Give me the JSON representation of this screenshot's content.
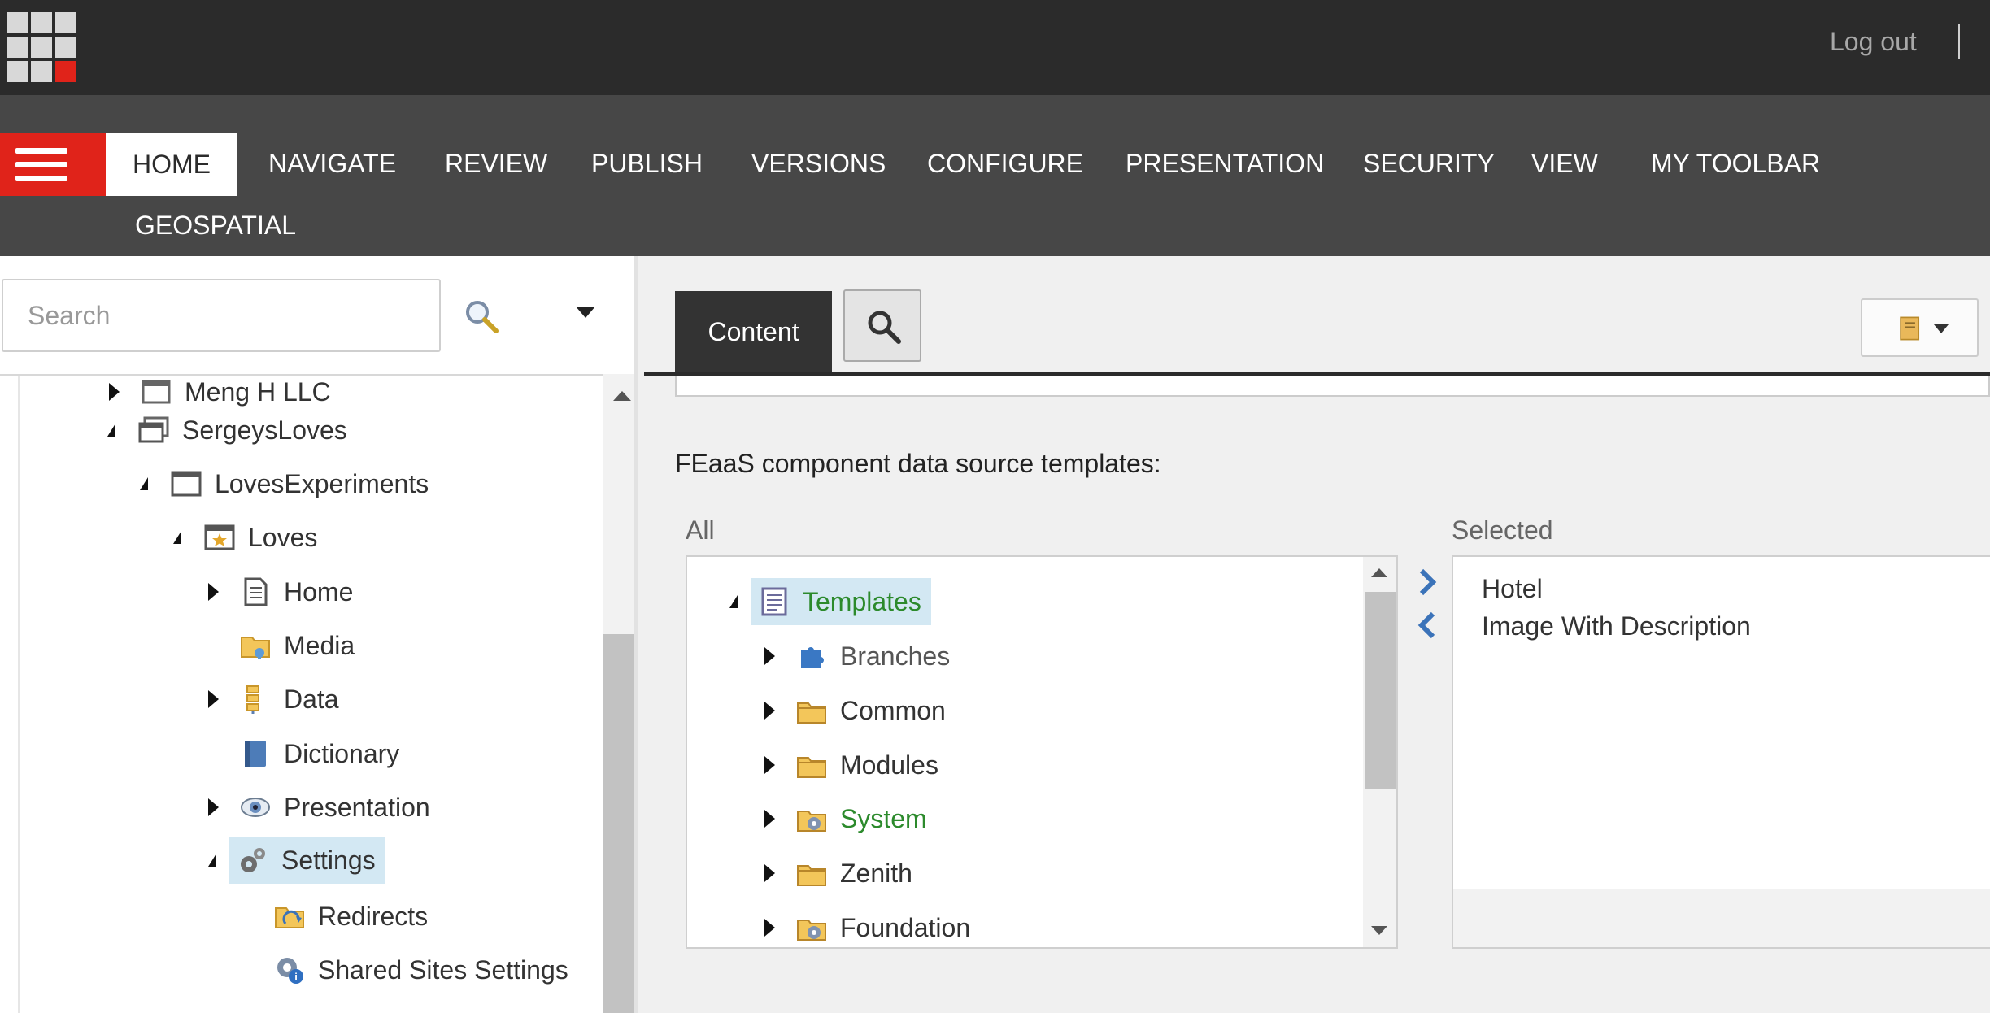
{
  "header": {
    "logout_label": "Log out"
  },
  "ribbon": {
    "tabs": [
      "HOME",
      "NAVIGATE",
      "REVIEW",
      "PUBLISH",
      "VERSIONS",
      "CONFIGURE",
      "PRESENTATION",
      "SECURITY",
      "VIEW",
      "MY TOOLBAR",
      "GEOSPATIAL"
    ],
    "active_tab": "HOME"
  },
  "left_panel": {
    "search_placeholder": "Search",
    "tree": [
      {
        "label": "Meng H LLC"
      },
      {
        "label": "SergeysLoves"
      },
      {
        "label": "LovesExperiments"
      },
      {
        "label": "Loves"
      },
      {
        "label": "Home"
      },
      {
        "label": "Media"
      },
      {
        "label": "Data"
      },
      {
        "label": "Dictionary"
      },
      {
        "label": "Presentation"
      },
      {
        "label": "Settings"
      },
      {
        "label": "Redirects"
      },
      {
        "label": "Shared Sites Settings"
      }
    ]
  },
  "editor": {
    "content_tab_label": "Content",
    "field_label": "FEaaS component data source templates:",
    "all_label": "All",
    "selected_label": "Selected",
    "all_tree": [
      {
        "label": "Templates"
      },
      {
        "label": "Branches"
      },
      {
        "label": "Common"
      },
      {
        "label": "Modules"
      },
      {
        "label": "System"
      },
      {
        "label": "Zenith"
      },
      {
        "label": "Foundation"
      }
    ],
    "selected_items": [
      "Hotel",
      "Image With Description"
    ]
  },
  "colors": {
    "brand_red": "#e0231a",
    "topbar": "#2b2b2b",
    "ribbon": "#474747",
    "selection": "#d3e8f3",
    "green_text": "#2c8a2c"
  }
}
